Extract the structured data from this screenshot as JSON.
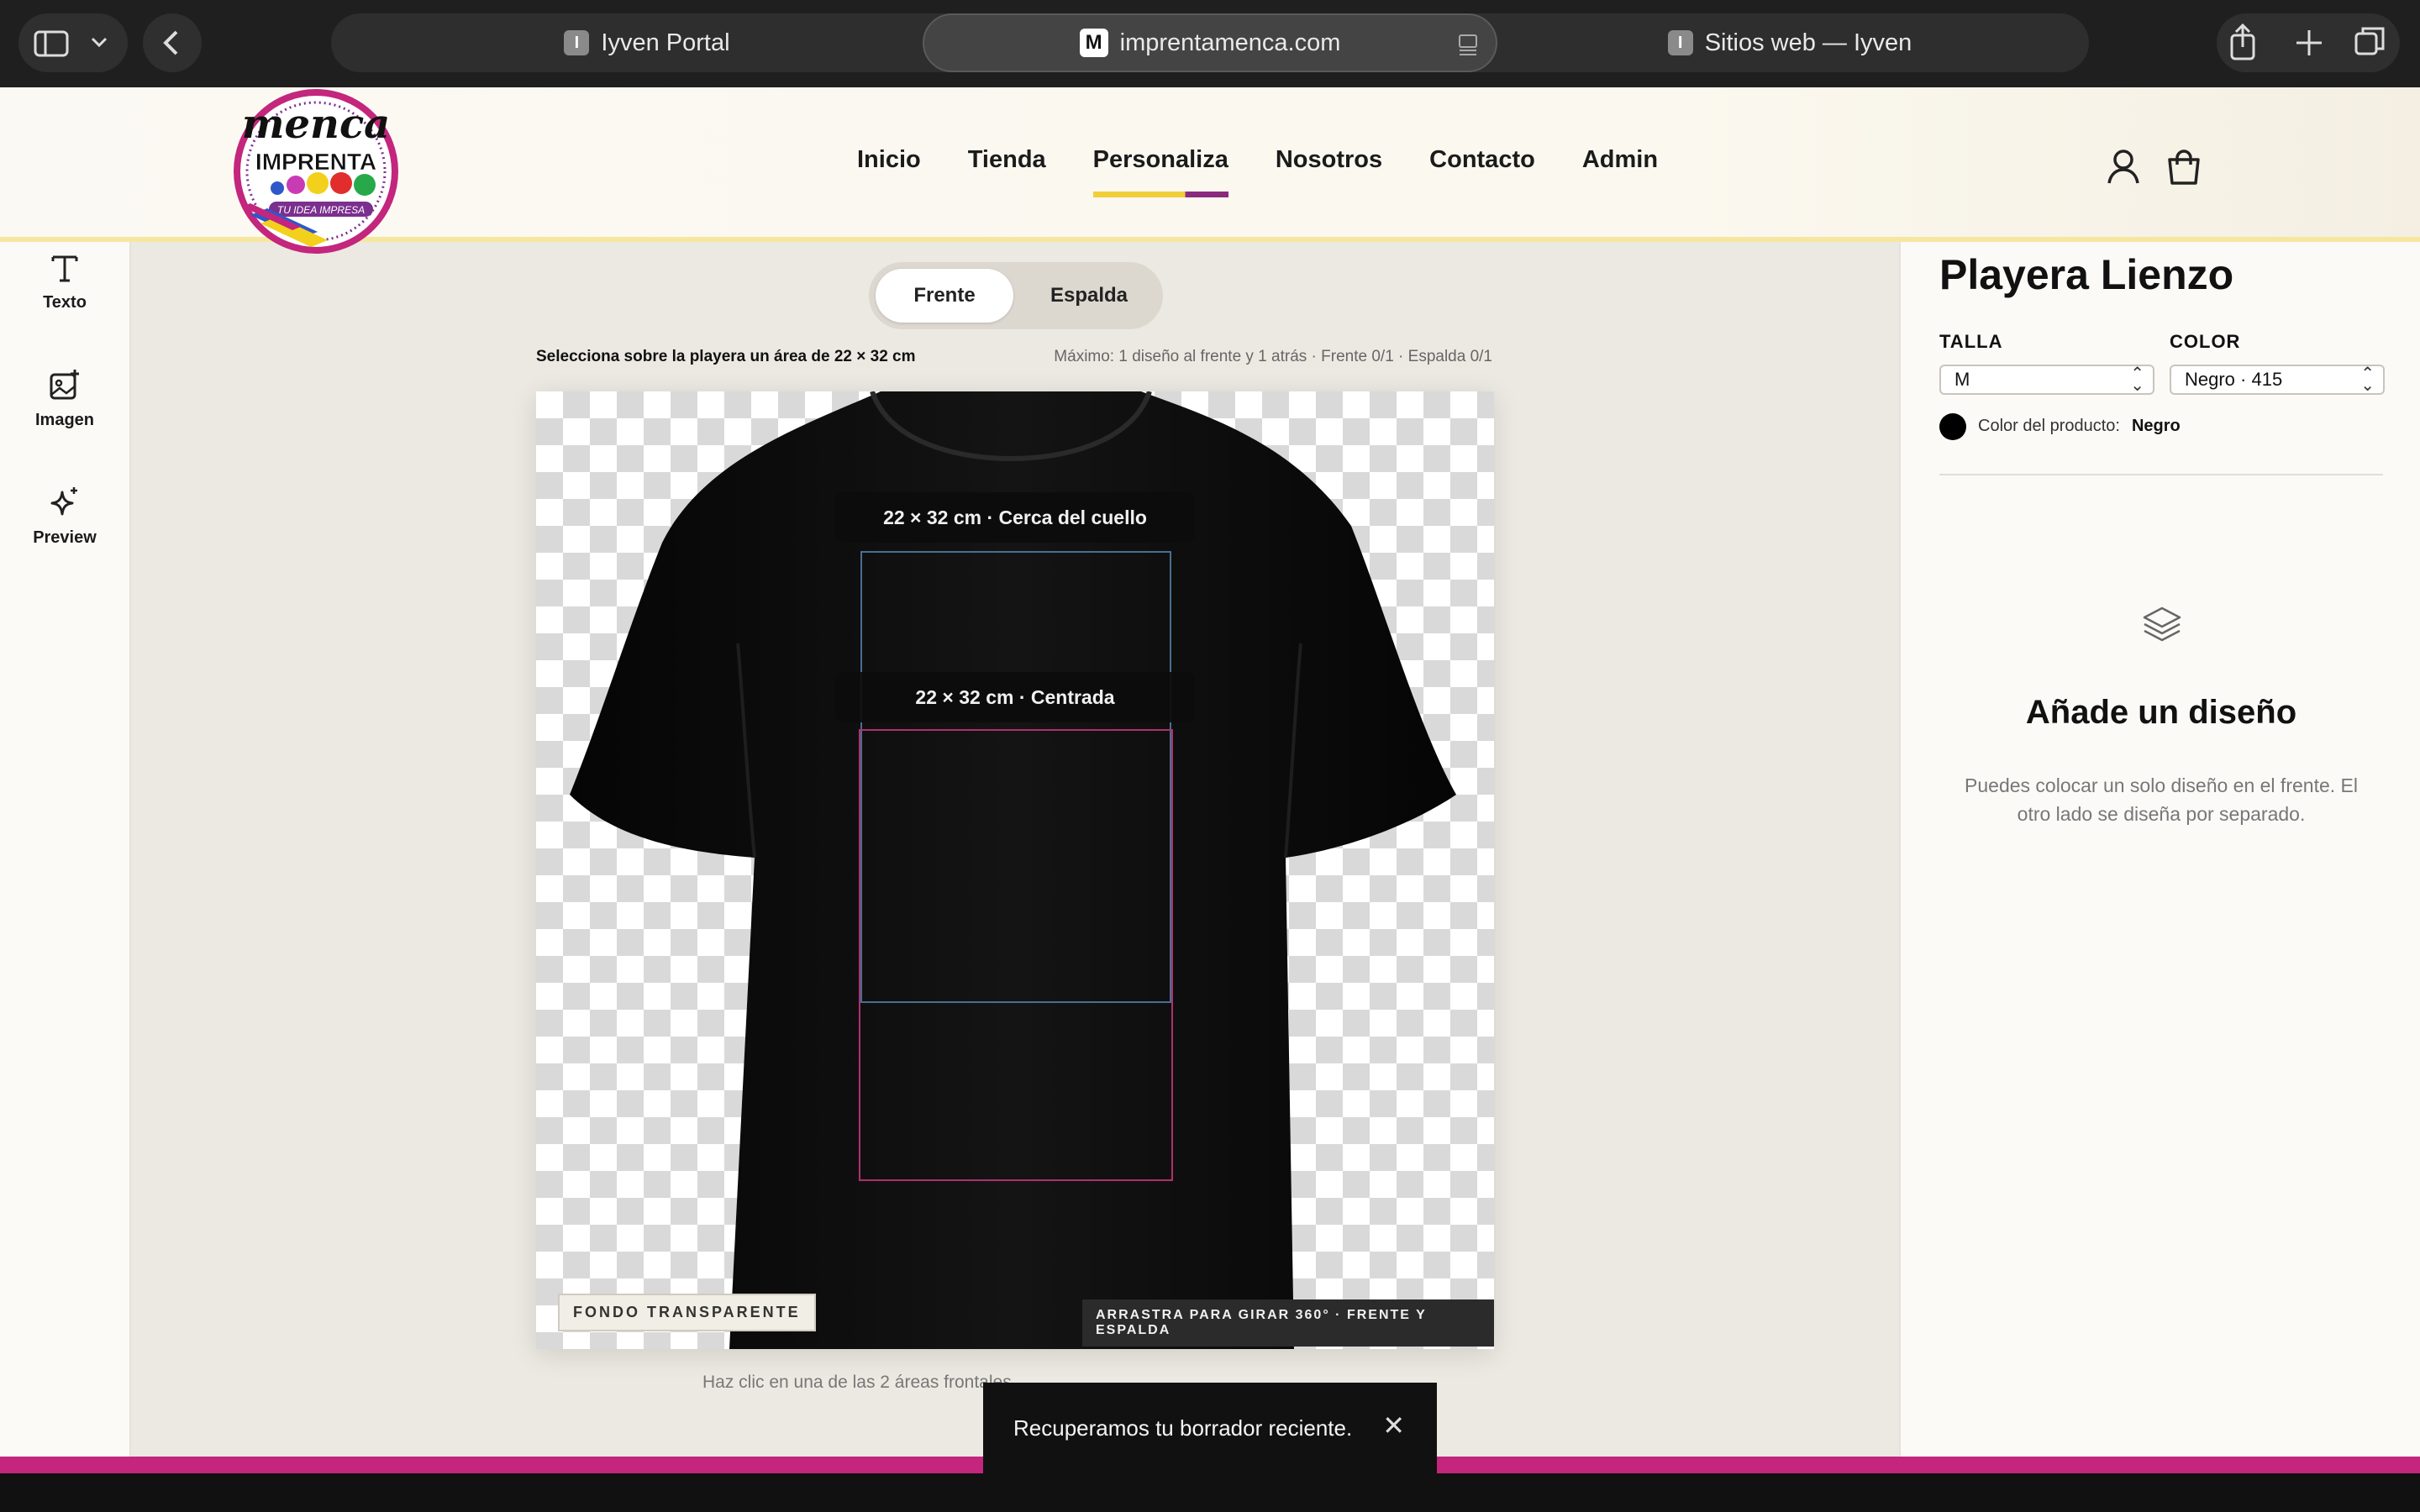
{
  "browser": {
    "tabs": [
      {
        "favicon": "I",
        "title": "Iyven Portal"
      },
      {
        "favicon": "M",
        "title": "imprentamenca.com"
      },
      {
        "favicon": "I",
        "title": "Sitios web — Iyven"
      }
    ]
  },
  "site": {
    "logo": {
      "top": "menca",
      "middle": "IMPRENTA",
      "tagline": "TU IDEA IMPRESA"
    },
    "nav": [
      "Inicio",
      "Tienda",
      "Personaliza",
      "Nosotros",
      "Contacto",
      "Admin"
    ],
    "active_nav": "Personaliza"
  },
  "toolbar": {
    "items": [
      {
        "label": "Texto",
        "icon": "text-icon"
      },
      {
        "label": "Imagen",
        "icon": "image-add-icon"
      },
      {
        "label": "Preview",
        "icon": "sparkle-icon"
      }
    ]
  },
  "editor": {
    "sides": [
      "Frente",
      "Espalda"
    ],
    "active_side": "Frente",
    "instruction": "Selecciona sobre la playera un área de 22 × 32 cm",
    "limit": "Máximo: 1 diseño al frente y 1 atrás · Frente 0/1 · Espalda 0/1",
    "areas": [
      {
        "label": "22 × 32 cm · Cerca del cuello",
        "color": "#4a6e93"
      },
      {
        "label": "22 × 32 cm · Centrada",
        "color": "#b0306f"
      }
    ],
    "bg_tag": "FONDO TRANSPARENTE",
    "rotate_tag": "ARRASTRA PARA GIRAR 360° · FRENTE Y ESPALDA",
    "bottom_hint": "Haz clic en una de las 2 áreas frontales"
  },
  "product": {
    "title": "Playera Lienzo",
    "size_label": "TALLA",
    "size_value": "M",
    "color_label": "COLOR",
    "color_value": "Negro · 415",
    "color_caption": "Color del producto:",
    "color_name": "Negro",
    "swatch_color": "#000000"
  },
  "empty_state": {
    "title": "Añade un diseño",
    "text": "Puedes colocar un solo diseño en el frente. El otro lado se diseña por separado."
  },
  "toast": {
    "message": "Recuperamos tu borrador reciente."
  },
  "colors": {
    "brand_magenta": "#c3267c",
    "brand_yellow": "#f1cf3a",
    "brand_purple": "#8a2a7e"
  }
}
